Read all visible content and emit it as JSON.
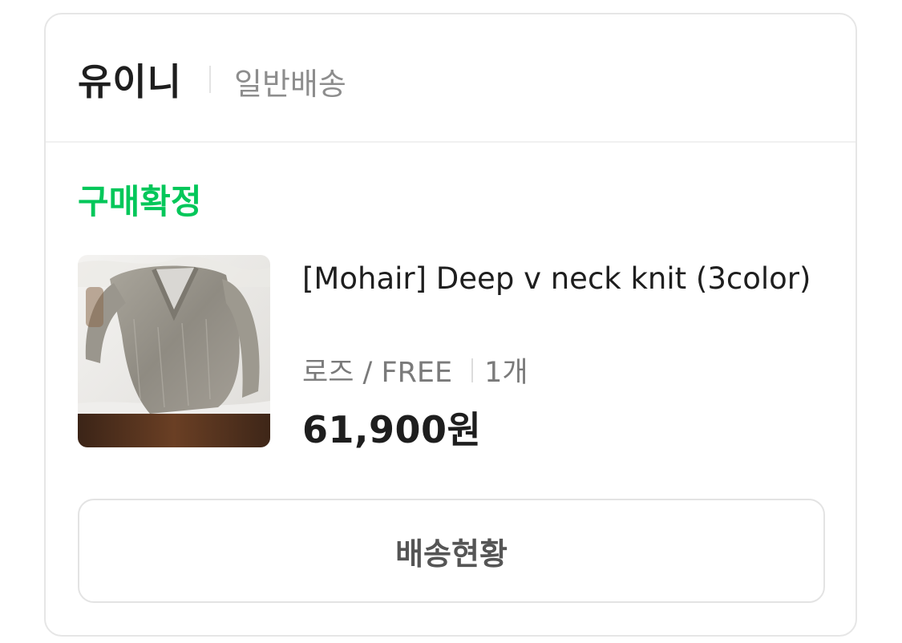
{
  "store": {
    "name": "유이니",
    "delivery_type": "일반배송"
  },
  "order": {
    "status": "구매확정",
    "status_color": "#03c75a",
    "product": {
      "title": "[Mohair] Deep v neck knit (3color)",
      "option": "로즈 / FREE",
      "quantity": "1개",
      "price": "61,900원",
      "image_desc_icon": "sweater-photo"
    }
  },
  "actions": {
    "track_label": "배송현황"
  }
}
